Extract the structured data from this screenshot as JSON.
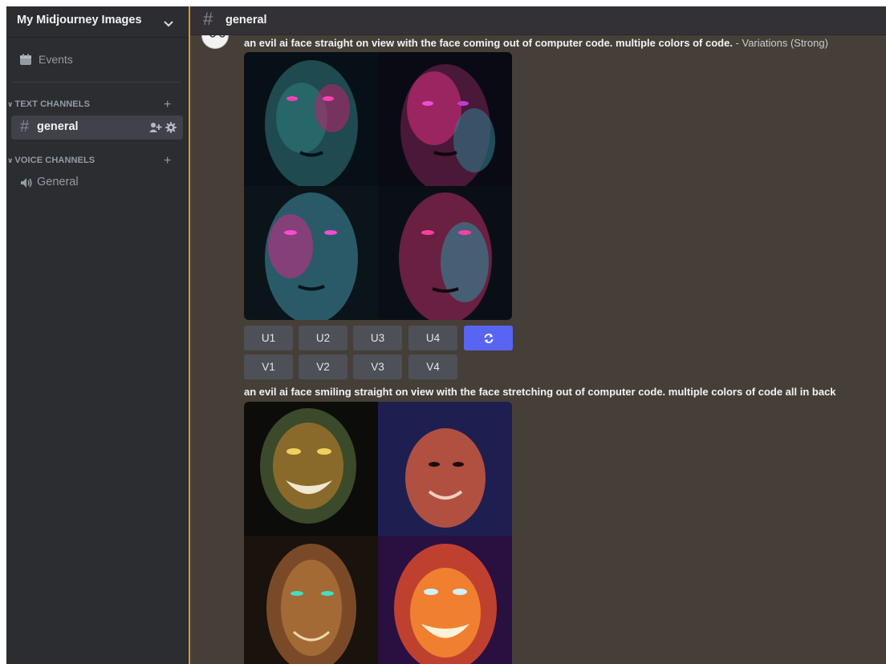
{
  "server": {
    "name": "My Midjourney Images"
  },
  "sidebar": {
    "events_label": "Events",
    "text_category": "TEXT CHANNELS",
    "voice_category": "VOICE CHANNELS",
    "text_channels": [
      {
        "name": "general"
      }
    ],
    "voice_channels": [
      {
        "name": "General"
      }
    ]
  },
  "channel_header": {
    "name": "general"
  },
  "messages": [
    {
      "prompt": "an evil ai face straight on view with the face coming out of computer code. multiple colors of code.",
      "suffix": " - Variations (Strong)",
      "upscale_buttons": [
        "U1",
        "U2",
        "U3",
        "U4"
      ],
      "variation_buttons": [
        "V1",
        "V2",
        "V3",
        "V4"
      ]
    },
    {
      "prompt": "an evil ai face smiling straight on view with the face stretching out of computer code. multiple colors of code all in back"
    }
  ],
  "colors": {
    "accent": "#5865f2",
    "sidebar_bg": "#2b2d31",
    "main_bg": "#453f38",
    "new_message_bar": "#d39b25"
  }
}
